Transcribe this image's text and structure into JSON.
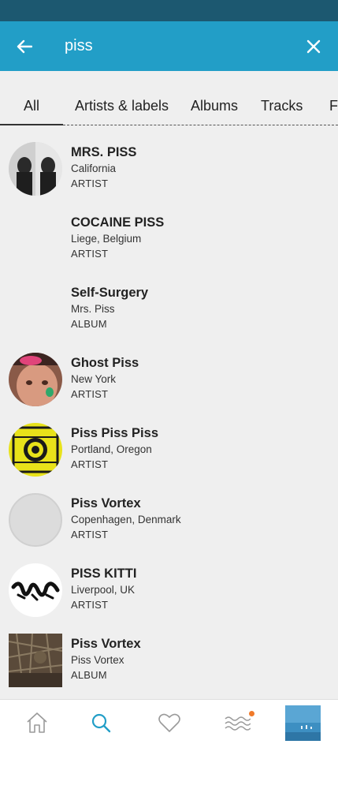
{
  "header": {
    "query": "piss",
    "back_icon": "arrow-left-icon",
    "clear_icon": "close-icon",
    "background": "#229ec7"
  },
  "tabs": [
    {
      "label": "All",
      "active": true
    },
    {
      "label": "Artists & labels",
      "active": false
    },
    {
      "label": "Albums",
      "active": false
    },
    {
      "label": "Tracks",
      "active": false
    },
    {
      "label": "Fans",
      "active": false
    }
  ],
  "results": [
    {
      "title": "MRS. PISS",
      "subtitle": "California",
      "type": "ARTIST",
      "thumb": "photo-duo"
    },
    {
      "title": "COCAINE PISS",
      "subtitle": "Liege, Belgium",
      "type": "ARTIST",
      "thumb": "none"
    },
    {
      "title": "Self-Surgery",
      "subtitle": "Mrs. Piss",
      "type": "ALBUM",
      "thumb": "none"
    },
    {
      "title": "Ghost Piss",
      "subtitle": "New York",
      "type": "ARTIST",
      "thumb": "photo-face"
    },
    {
      "title": "Piss Piss Piss",
      "subtitle": "Portland, Oregon",
      "type": "ARTIST",
      "thumb": "yellow-art"
    },
    {
      "title": "Piss Vortex",
      "subtitle": "Copenhagen, Denmark",
      "type": "ARTIST",
      "thumb": "placeholder"
    },
    {
      "title": "PISS KITTI",
      "subtitle": "Liverpool, UK",
      "type": "ARTIST",
      "thumb": "logo-art"
    },
    {
      "title": "Piss Vortex",
      "subtitle": "Piss Vortex",
      "type": "ALBUM",
      "thumb": "album-art"
    }
  ],
  "bottom_nav": [
    {
      "name": "home-icon",
      "active": false
    },
    {
      "name": "search-icon",
      "active": true
    },
    {
      "name": "heart-icon",
      "active": false
    },
    {
      "name": "feed-waves-icon",
      "active": false,
      "notification": true
    },
    {
      "name": "now-playing-thumb",
      "active": false
    }
  ],
  "colors": {
    "accent": "#229ec7",
    "status_bar": "#1c5870",
    "notification": "#f07a2a"
  }
}
